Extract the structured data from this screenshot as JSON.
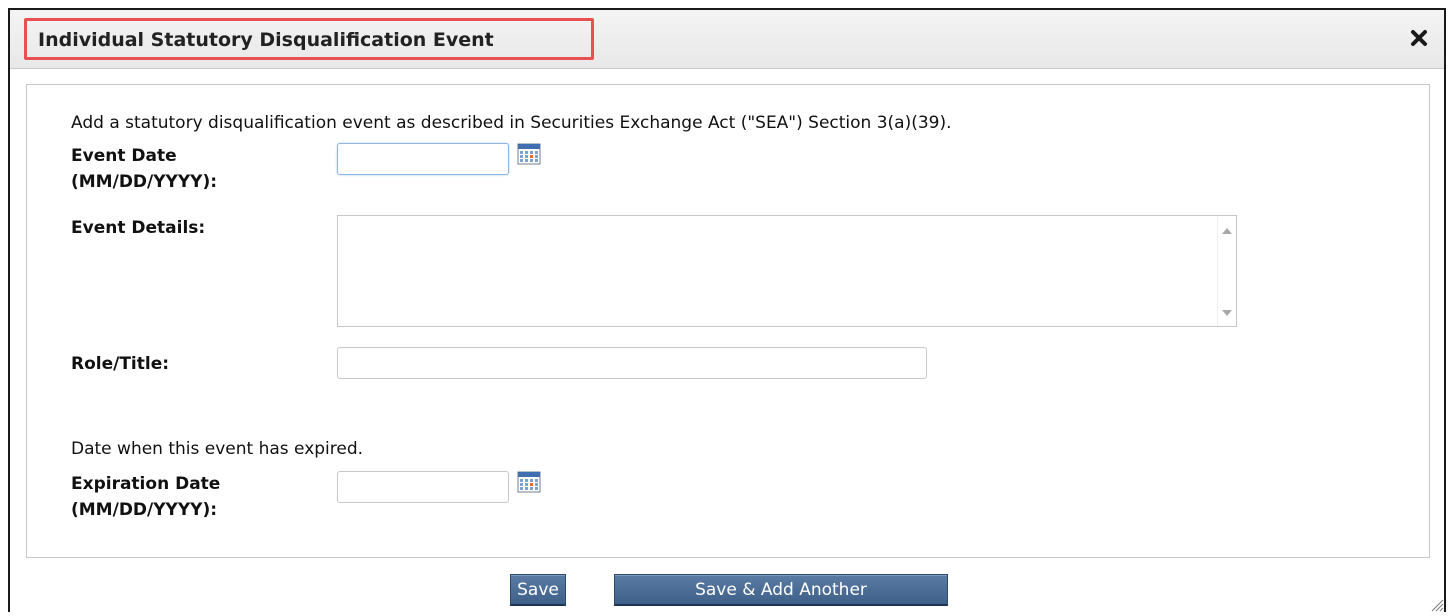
{
  "dialog": {
    "title": "Individual Statutory Disqualification Event",
    "close_icon": "close-icon"
  },
  "form": {
    "intro": "Add a statutory disqualification event as described in Securities Exchange Act (\"SEA\") Section 3(a)(39).",
    "event_date_label_line1": "Event Date",
    "event_date_label_line2": "(MM/DD/YYYY):",
    "event_date_value": "",
    "event_details_label": "Event Details:",
    "event_details_value": "",
    "role_title_label": "Role/Title:",
    "role_title_value": "",
    "expired_note": "Date when this event has expired.",
    "expiration_date_label_line1": "Expiration Date",
    "expiration_date_label_line2": "(MM/DD/YYYY):",
    "expiration_date_value": "",
    "calendar_icon": "calendar-icon"
  },
  "buttons": {
    "save": "Save",
    "save_add_another": "Save & Add Another"
  },
  "colors": {
    "title_highlight": "#e8514f",
    "button_bg": "#4a6b94",
    "focus_border": "#8db6e6"
  }
}
